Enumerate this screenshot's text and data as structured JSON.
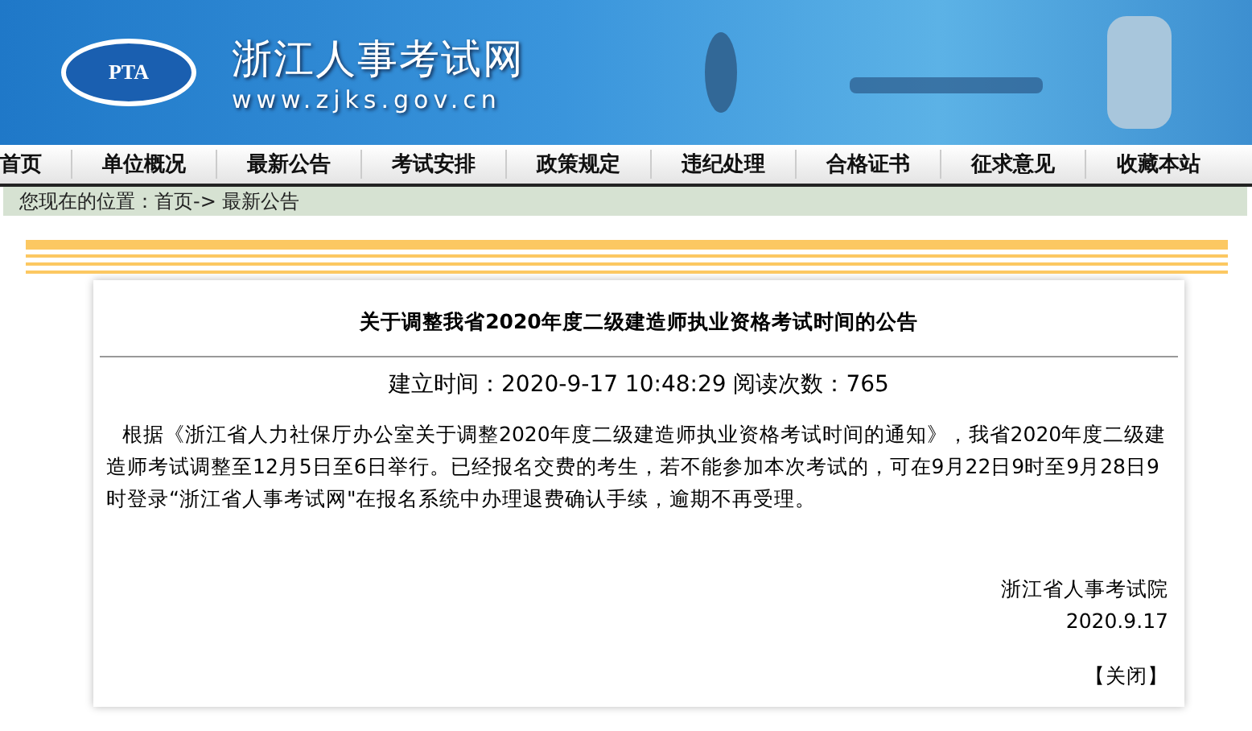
{
  "header": {
    "logo_text": "PTA",
    "site_name": "浙江人事考试网",
    "site_url": "www.zjks.gov.cn"
  },
  "nav": [
    "首页",
    "单位概况",
    "最新公告",
    "考试安排",
    "政策规定",
    "违纪处理",
    "合格证书",
    "征求意见",
    "收藏本站"
  ],
  "breadcrumb": "您现在的位置：首页-> 最新公告",
  "article": {
    "title": "关于调整我省2020年度二级建造师执业资格考试时间的公告",
    "meta": "建立时间：2020-9-17 10:48:29 阅读次数：765",
    "body": "根据《浙江省人力社保厅办公室关于调整2020年度二级建造师执业资格考试时间的通知》，我省2020年度二级建造师考试调整至12月5日至6日举行。已经报名交费的考生，若不能参加本次考试的，可在9月22日9时至9月28日9时登录“浙江省人事考试网\"在报名系统中办理退费确认手续，逾期不再受理。",
    "signature": "浙江省人事考试院",
    "date": "2020.9.17",
    "close": "【关闭】"
  }
}
